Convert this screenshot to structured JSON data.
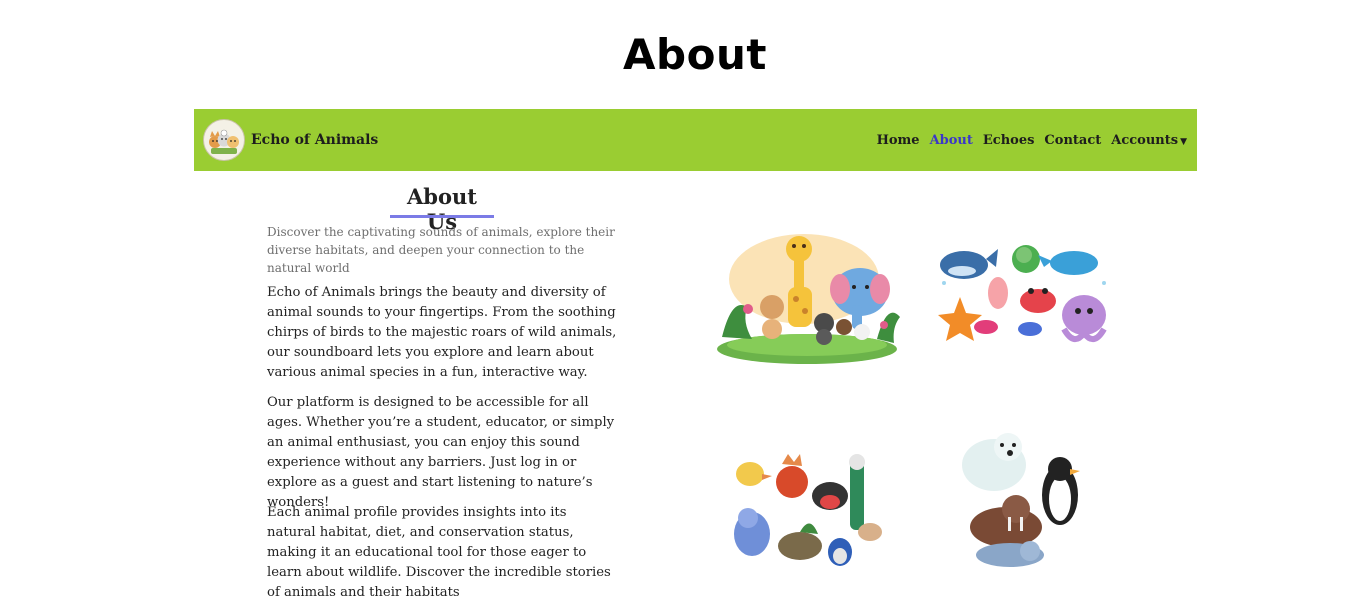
{
  "page": {
    "heading": "About"
  },
  "navbar": {
    "brand_name": "Echo of Animals",
    "links": [
      {
        "label": "Home"
      },
      {
        "label": "About",
        "active": true
      },
      {
        "label": "Echoes"
      },
      {
        "label": "Contact"
      },
      {
        "label": "Accounts"
      }
    ],
    "background": "#9acd32",
    "active_color": "#3b37c9"
  },
  "about": {
    "title": "About Us",
    "subtitle": "Discover the captivating sounds of animals, explore their diverse habitats, and deepen your connection to the natural world",
    "paragraphs": [
      "Echo of Animals brings the beauty and diversity of animal sounds to your fingertips. From the soothing chirps of birds to the majestic roars of wild animals, our soundboard lets you explore and learn about various animal species in a fun, interactive way.",
      "Our platform is designed to be accessible for all ages. Whether you’re a student, educator, or simply an animal enthusiast, you can enjoy this sound experience without any barriers. Just log in or explore as a guest and start listening to nature’s wonders!",
      "Each animal profile provides insights into its natural habitat, diet, and conservation status, making it an educational tool for those eager to learn about wildlife. Discover the incredible stories of animals and their habitats"
    ]
  },
  "images": [
    {
      "icon": "jungle-animals-illustration"
    },
    {
      "icon": "sea-animals-illustration"
    },
    {
      "icon": "birds-illustration"
    },
    {
      "icon": "polar-animals-illustration"
    }
  ]
}
